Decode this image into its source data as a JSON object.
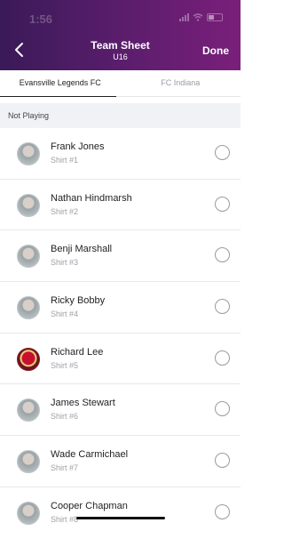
{
  "status_bar": {
    "time": "1:56"
  },
  "header": {
    "title": "Team Sheet",
    "subtitle": "U16",
    "done_label": "Done"
  },
  "tabs": [
    {
      "label": "Evansville Legends FC",
      "active": true
    },
    {
      "label": "FC Indiana",
      "active": false
    }
  ],
  "section_label": "Not Playing",
  "players": [
    {
      "name": "Frank Jones",
      "shirt": "Shirt #1"
    },
    {
      "name": "Nathan Hindmarsh",
      "shirt": "Shirt #2"
    },
    {
      "name": "Benji Marshall",
      "shirt": "Shirt #3"
    },
    {
      "name": "Ricky Bobby",
      "shirt": "Shirt #4"
    },
    {
      "name": "Richard Lee",
      "shirt": "Shirt #5"
    },
    {
      "name": "James Stewart",
      "shirt": "Shirt #6"
    },
    {
      "name": "Wade Carmichael",
      "shirt": "Shirt #7"
    },
    {
      "name": "Cooper Chapman",
      "shirt": "Shirt #8"
    }
  ],
  "colors": {
    "header_start": "#3a1a58",
    "header_end": "#7a1f7a"
  }
}
